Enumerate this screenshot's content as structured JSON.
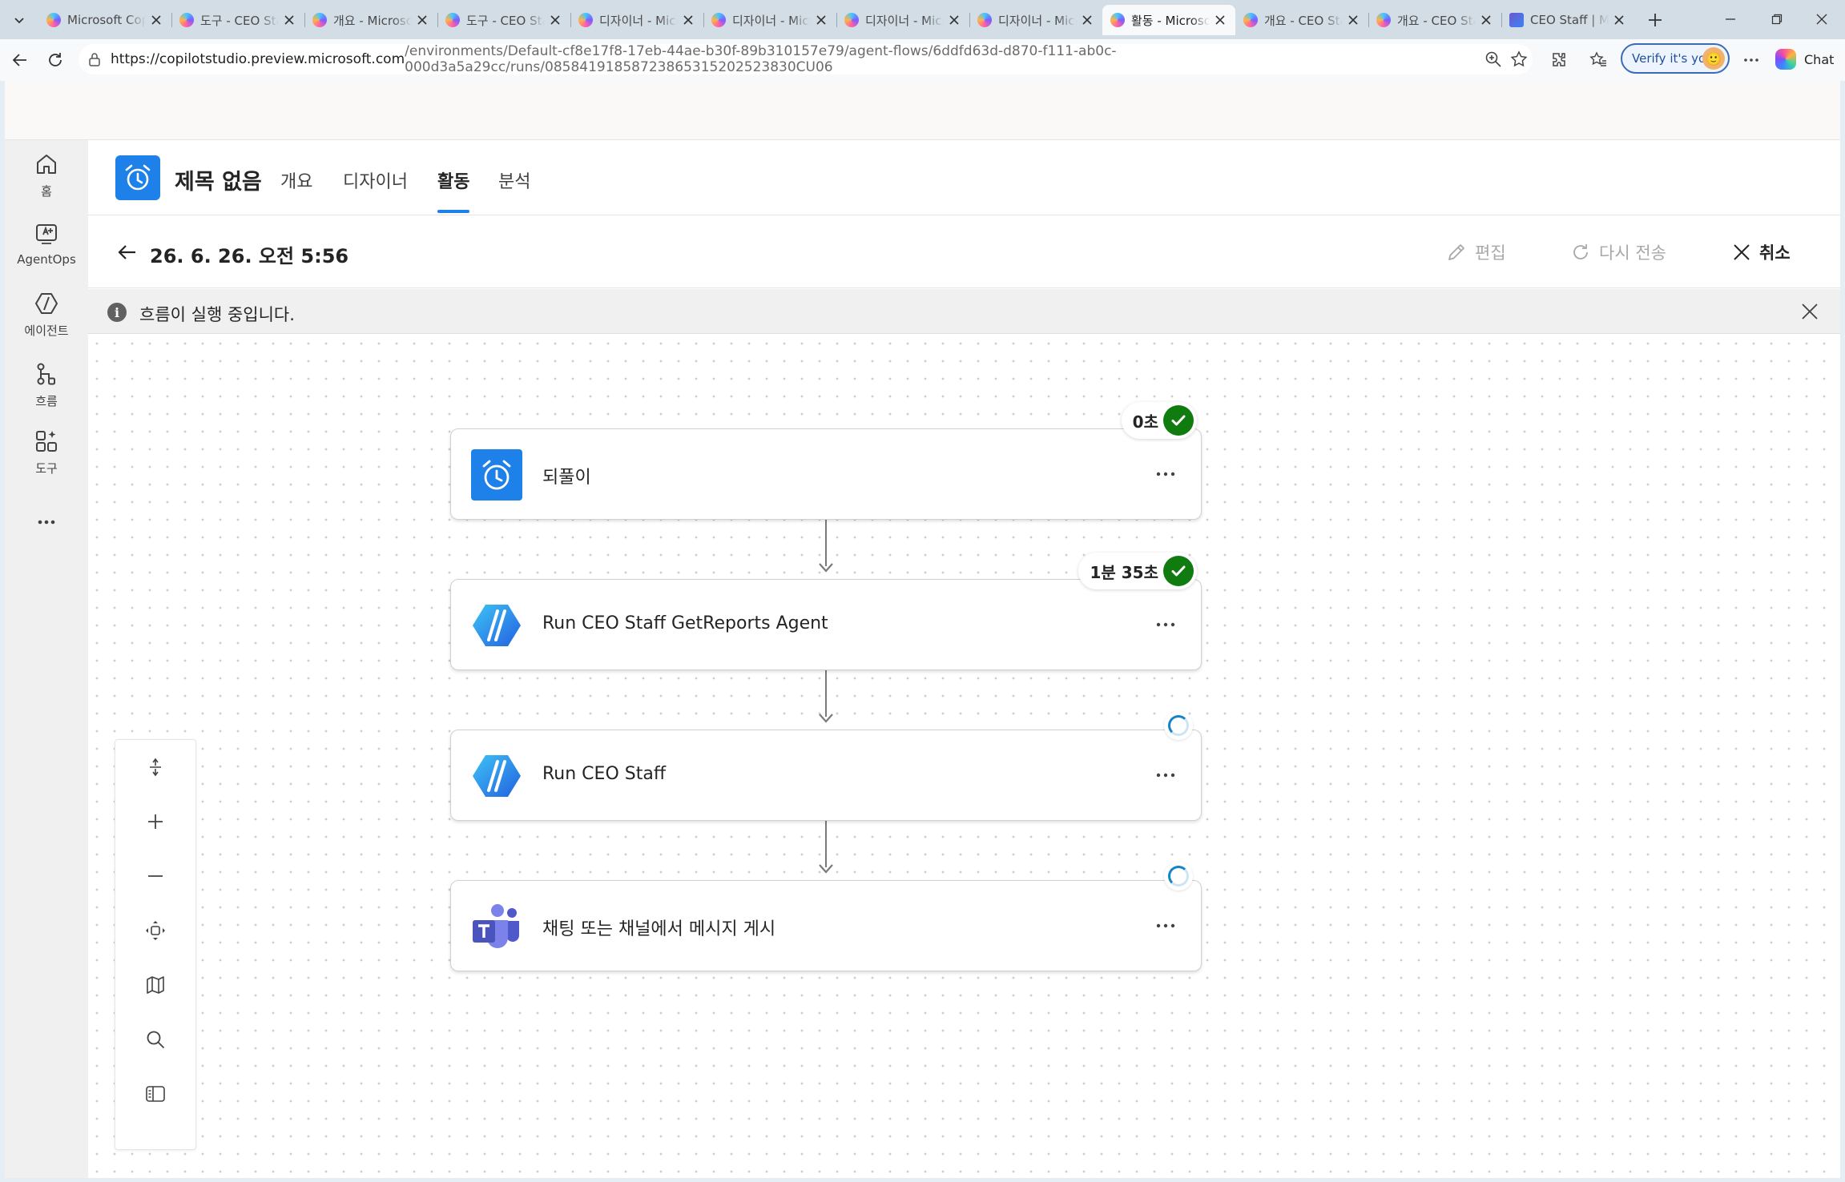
{
  "browser": {
    "tabs": [
      {
        "title": "Microsoft Copilot Studio",
        "icon": "copilot-studio-icon",
        "active": false
      },
      {
        "title": "도구 - CEO Staff",
        "icon": "copilot-studio-icon",
        "active": false
      },
      {
        "title": "개요 - Microsoft",
        "icon": "copilot-studio-icon",
        "active": false
      },
      {
        "title": "도구 - CEO Staff",
        "icon": "copilot-studio-icon",
        "active": false
      },
      {
        "title": "디자이너 - Microsoft",
        "icon": "copilot-studio-icon",
        "active": false
      },
      {
        "title": "디자이너 - Microsoft",
        "icon": "copilot-studio-icon",
        "active": false
      },
      {
        "title": "디자이너 - Microsoft",
        "icon": "copilot-studio-icon",
        "active": false
      },
      {
        "title": "디자이너 - Microsoft",
        "icon": "copilot-studio-icon",
        "active": false
      },
      {
        "title": "활동 - Microsoft",
        "icon": "copilot-studio-icon",
        "active": true
      },
      {
        "title": "개요 - CEO Staff",
        "icon": "copilot-studio-icon",
        "active": false
      },
      {
        "title": "개요 - CEO Staff",
        "icon": "copilot-studio-icon",
        "active": false
      },
      {
        "title": "CEO Staff | Microsoft",
        "icon": "staff-app-icon",
        "active": false
      }
    ],
    "url_host": "https://copilotstudio.preview.microsoft.com",
    "url_path": "/environments/Default-cf8e17f8-17eb-44ae-b30f-89b310157e79/agent-flows/6ddfd63d-d870-f111-ab0c-000d3a5a29cc/runs/08584191858723865315202523830CU06",
    "verify_label": "Verify it's you",
    "chat_label": "Chat"
  },
  "rail": {
    "items": [
      {
        "label": "홈",
        "icon": "home-icon"
      },
      {
        "label": "AgentOps",
        "icon": "agentops-icon"
      },
      {
        "label": "에이전트",
        "icon": "agents-icon"
      },
      {
        "label": "흐름",
        "icon": "flows-icon"
      },
      {
        "label": "도구",
        "icon": "tools-icon"
      }
    ],
    "more_label": "..."
  },
  "flow": {
    "title": "제목 없음",
    "tabs": [
      {
        "label": "개요",
        "active": false
      },
      {
        "label": "디자이너",
        "active": false
      },
      {
        "label": "활동",
        "active": true
      },
      {
        "label": "분석",
        "active": false
      }
    ]
  },
  "run": {
    "timestamp": "26. 6. 26. 오전 5:56",
    "edit_label": "편집",
    "resubmit_label": "다시 전송",
    "cancel_label": "취소"
  },
  "banner": {
    "icon_glyph": "i",
    "message": "흐름이 실행 중입니다."
  },
  "steps": [
    {
      "label": "되풀이",
      "icon": "recurrence-alarm-icon",
      "status": "succeeded",
      "duration": "0초"
    },
    {
      "label": "Run CEO Staff GetReports Agent",
      "icon": "copilot-agent-icon",
      "status": "succeeded",
      "duration": "1분 35초"
    },
    {
      "label": "Run CEO Staff",
      "icon": "copilot-agent-icon",
      "status": "running",
      "duration": ""
    },
    {
      "label": "채팅 또는 채널에서 메시지 게시",
      "icon": "teams-icon",
      "status": "running",
      "duration": ""
    }
  ],
  "more_glyph": "···",
  "colors": {
    "accent": "#1e80e9",
    "success": "#107c10",
    "running": "#1483c7"
  }
}
